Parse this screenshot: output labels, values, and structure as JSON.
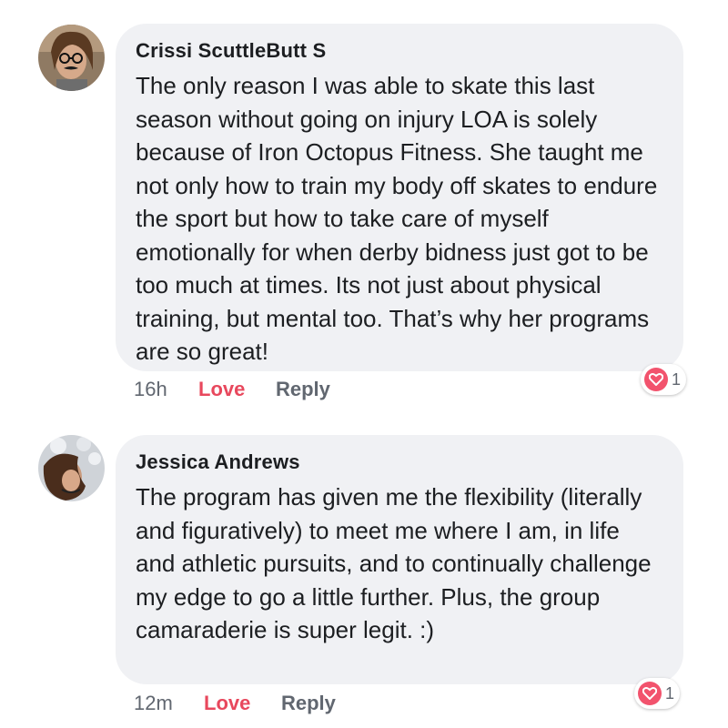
{
  "comments": [
    {
      "author": "Crissi ScuttleButt S",
      "text": "The only reason I was able to skate this last season without going on injury LOA is solely because of Iron Octopus Fitness. She taught me not only how to train my body off skates to endure the sport but how to take care of myself emotionally for when derby bidness just got to be too much at times. Its not just about physical training, but mental too. That’s why her programs are so great!",
      "time": "16h",
      "love_label": "Love",
      "reply_label": "Reply",
      "reaction_icon": "heart-icon",
      "reaction_count": "1"
    },
    {
      "author": "Jessica Andrews",
      "text": "The program has given me the flexibility (literally and figuratively) to meet me where I am, in life and athletic pursuits, and to continually challenge my edge to go a little further. Plus, the group camaraderie is super legit. :)",
      "time": "12m",
      "love_label": "Love",
      "reply_label": "Reply",
      "reaction_icon": "heart-icon",
      "reaction_count": "1"
    }
  ],
  "colors": {
    "bubble": "#f0f1f4",
    "love": "#e8485d",
    "meta": "#616770",
    "text": "#1c1e21",
    "reaction_heart": "#f2536d"
  }
}
